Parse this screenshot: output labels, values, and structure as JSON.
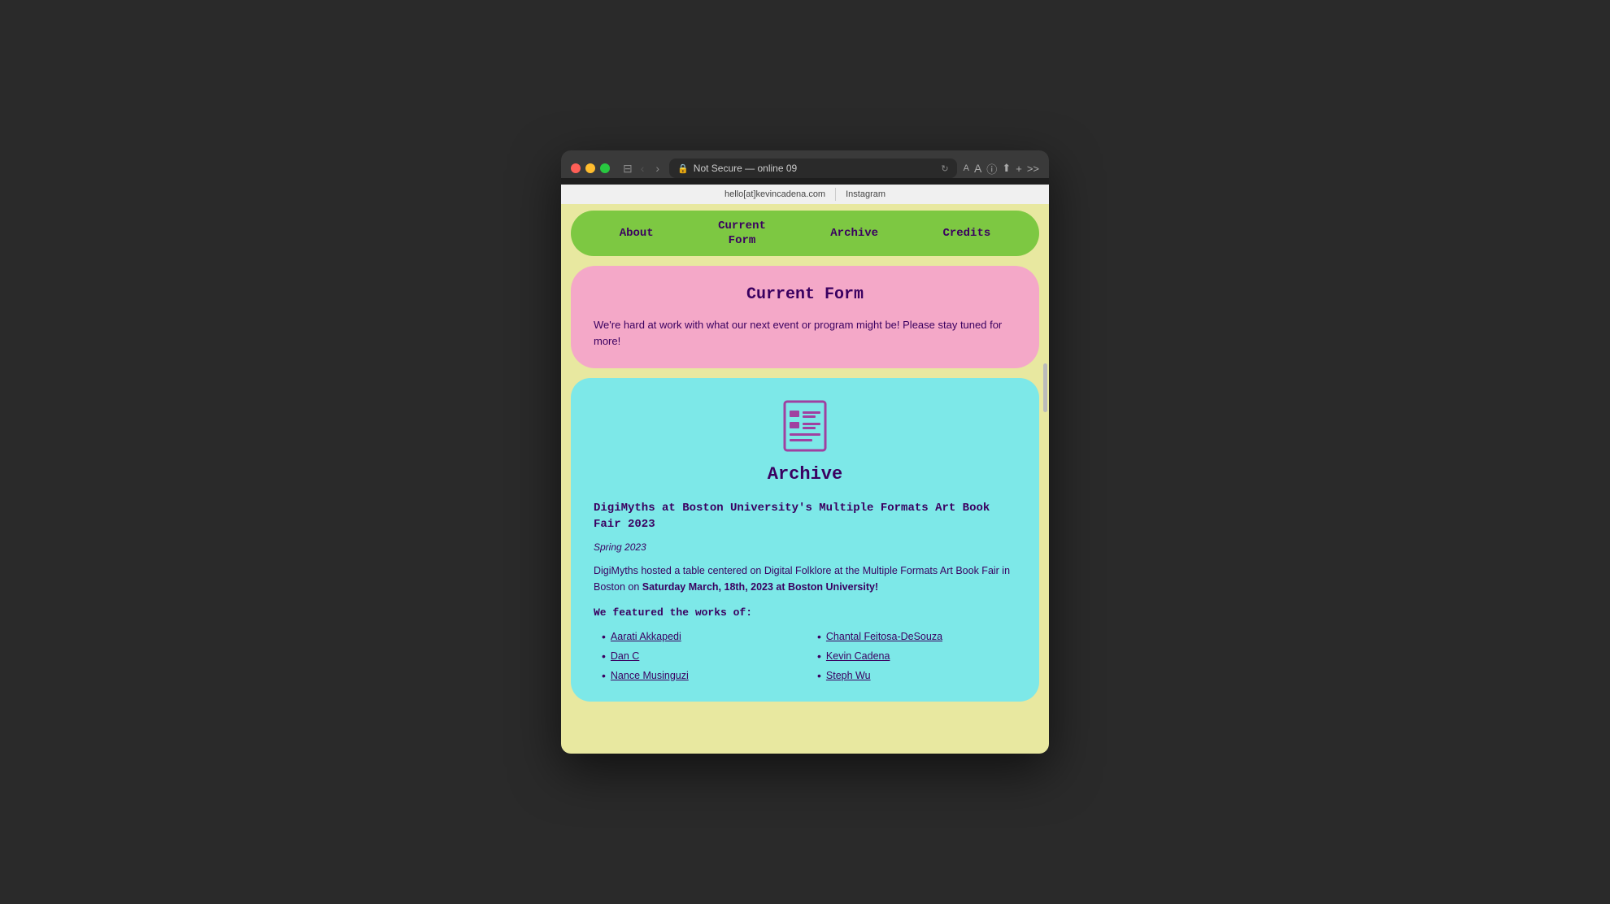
{
  "browser": {
    "address": "Not Secure — online 09",
    "full_url": "Not Secure — .online 09",
    "top_links": [
      {
        "label": "hello[at]kevincadena.com"
      },
      {
        "label": "Instagram"
      }
    ]
  },
  "nav": {
    "items": [
      {
        "label": "About",
        "id": "about"
      },
      {
        "label": "Current Form",
        "id": "current-form"
      },
      {
        "label": "Archive",
        "id": "archive"
      },
      {
        "label": "Credits",
        "id": "credits"
      }
    ]
  },
  "current_form": {
    "title": "Current Form",
    "body": "We're hard at work with what our next event or program might be! Please stay tuned for more!"
  },
  "archive": {
    "title": "Archive",
    "event": {
      "title": "DigiMyths at Boston University's Multiple Formats Art Book Fair 2023",
      "date": "Spring 2023",
      "description_before": "DigiMyths hosted a table centered on Digital Folklore at the Multiple Formats Art Book Fair in Boston on ",
      "description_bold": "Saturday March, 18th, 2023 at Boston University!",
      "featured_heading": "We featured the works of:",
      "artists": [
        {
          "name": "Aarati Akkapedi",
          "col": 0
        },
        {
          "name": "Chantal Feitosa-DeSouza",
          "col": 1
        },
        {
          "name": "Dan C",
          "col": 0
        },
        {
          "name": "Kevin Cadena",
          "col": 1
        },
        {
          "name": "Nance Musinguzi",
          "col": 0
        },
        {
          "name": "Steph Wu",
          "col": 1
        }
      ]
    }
  },
  "colors": {
    "nav_bg": "#7dc842",
    "current_form_bg": "#f4a8c8",
    "archive_bg": "#7de8e8",
    "page_bg": "#e8e8a0",
    "text_dark": "#3a0060"
  }
}
